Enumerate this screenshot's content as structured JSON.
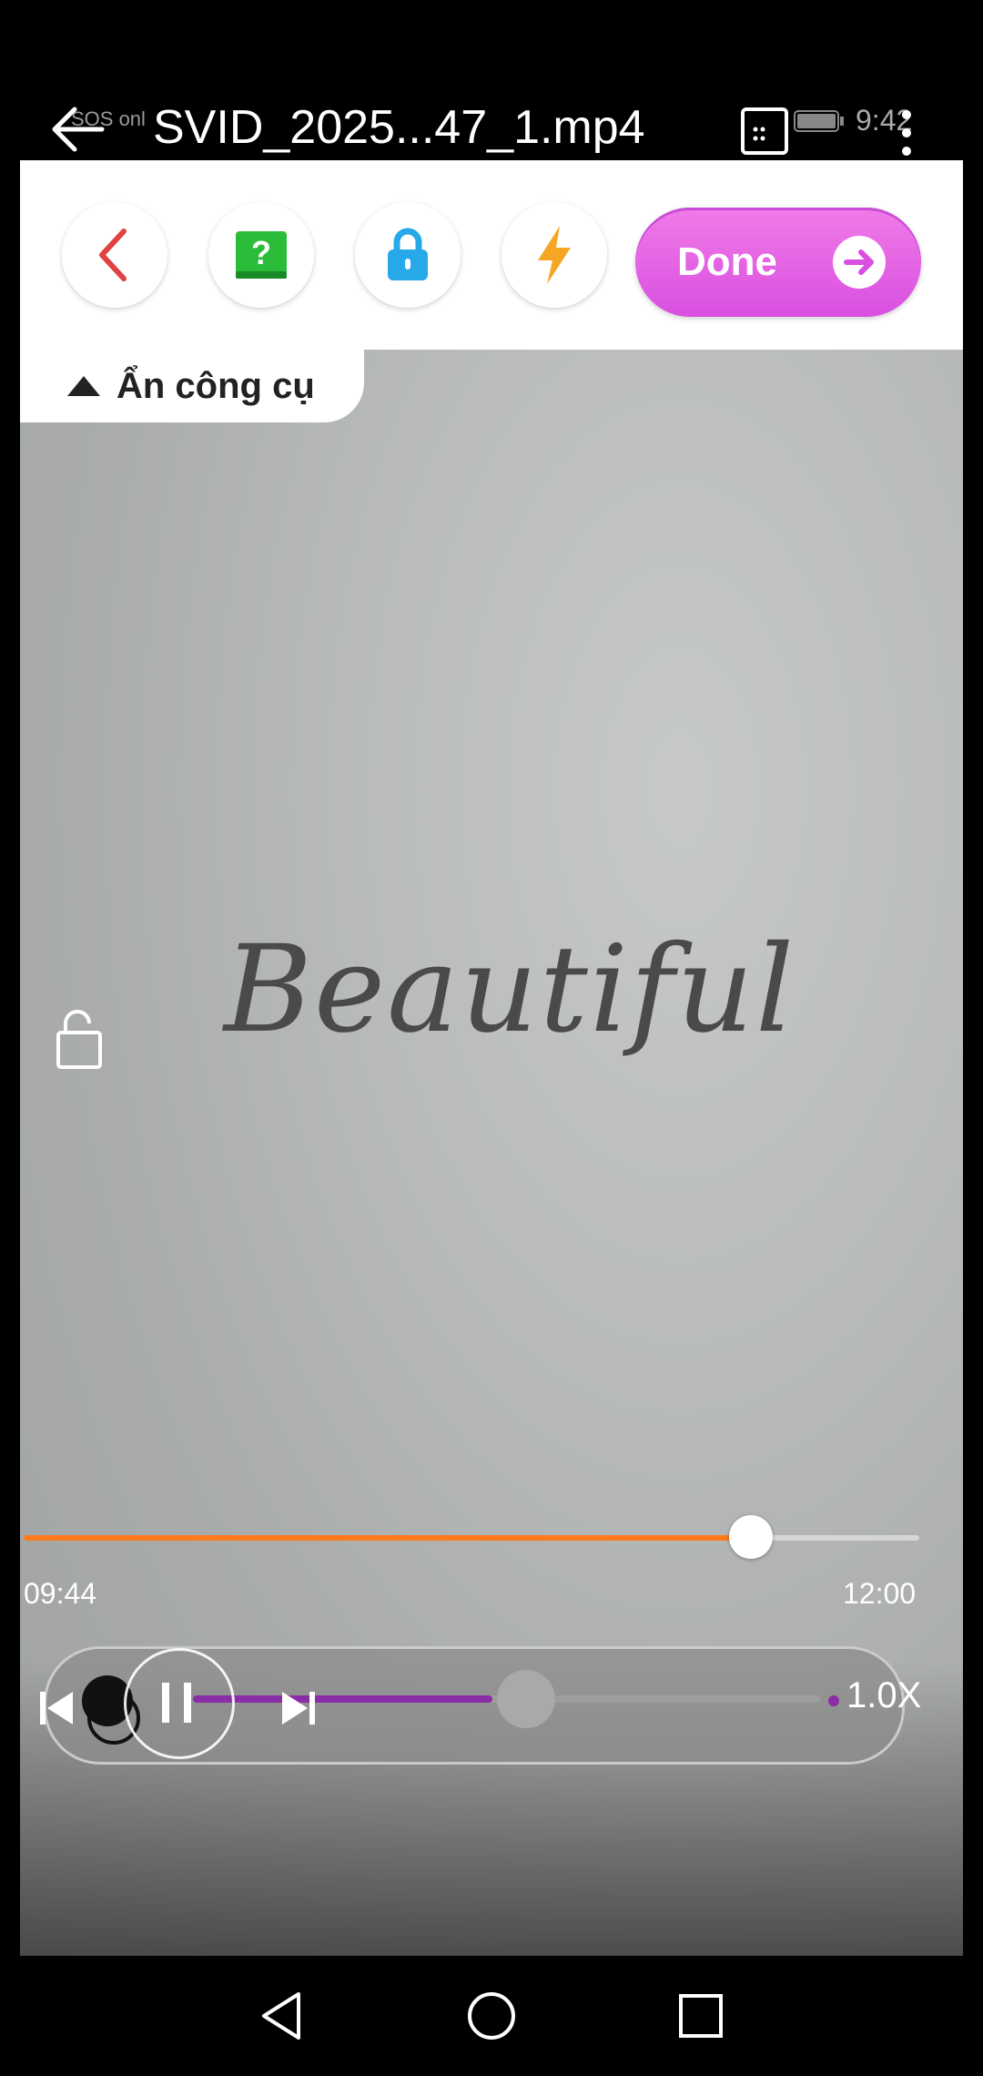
{
  "statusbar": {
    "sos_text": "SOS onl",
    "title": "SVID_2025...47_1.mp4",
    "clock": "9:42"
  },
  "toolbar": {
    "done_label": "Done",
    "buttons": [
      "back-chevron-icon",
      "quiz-book-icon",
      "lock-icon",
      "lightning-icon"
    ]
  },
  "hide_tools": {
    "label": "Ẩn công cụ"
  },
  "video": {
    "word": "Beautiful"
  },
  "player": {
    "current_time": "09:44",
    "total_time": "12:00",
    "progress": 0.812,
    "speed_label": "1.0X",
    "speed_position": 0.53
  },
  "colors": {
    "accent_orange": "#ff7a1a",
    "done_pink": "#e064e4",
    "speed_purple": "#8a2da6"
  }
}
